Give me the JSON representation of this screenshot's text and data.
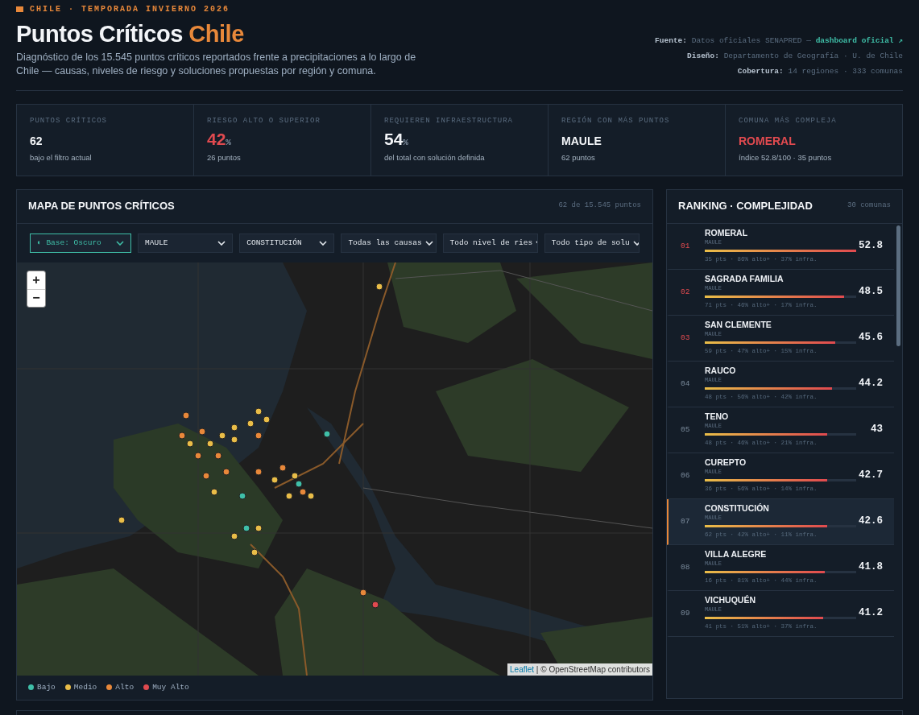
{
  "header": {
    "eyebrow": "CHILE · TEMPORADA INVIERNO 2026",
    "title": "Puntos Críticos",
    "title_accent": "Chile",
    "description": "Diagnóstico de los 15.545 puntos críticos reportados frente a precipitaciones a lo largo de Chile — causas, niveles de riesgo y soluciones propuestas por región y comuna.",
    "meta": [
      {
        "label": "Fuente:",
        "value": "Datos oficiales SENAPRED —",
        "link": "dashboard oficial ↗"
      },
      {
        "label": "Diseño:",
        "value": "Departamento de Geografía · U. de Chile"
      },
      {
        "label": "Cobertura:",
        "value": "14 regiones · 333 comunas"
      }
    ]
  },
  "stats": [
    {
      "label": "PUNTOS CRÍTICOS",
      "value": "62",
      "alert": false,
      "note": "bajo el filtro actual"
    },
    {
      "label": "RIESGO ALTO O SUPERIOR",
      "value": "42",
      "unit": "%",
      "alert": true,
      "note": "26 puntos"
    },
    {
      "label": "REQUIEREN INFRAESTRUCTURA",
      "value": "54",
      "unit": "%",
      "alert": false,
      "note": "del total con solución definida"
    },
    {
      "label": "REGIÓN CON MÁS PUNTOS",
      "value": "MAULE",
      "alert": false,
      "note": "62 puntos"
    },
    {
      "label": "COMUNA MÁS COMPLEJA",
      "value": "ROMERAL",
      "alert": true,
      "note": "índice 52.8/100 · 35 puntos"
    }
  ],
  "map_panel": {
    "title": "MAPA DE PUNTOS CRÍTICOS",
    "count": "62 de 15.545 puntos",
    "filters": [
      {
        "label": "Base: Oscuro",
        "icon": "◐",
        "active": true
      },
      {
        "label": "MAULE",
        "active": false
      },
      {
        "label": "CONSTITUCIÓN",
        "active": false
      },
      {
        "label": "Todas las causas",
        "active": false
      },
      {
        "label": "Todo nivel de ries",
        "active": false
      },
      {
        "label": "Todo tipo de solu",
        "active": false
      }
    ],
    "zoom": [
      "+",
      "−"
    ],
    "attribution": {
      "link": "Leaflet",
      "text": "| © OpenStreetMap contributors"
    },
    "legend": [
      {
        "label": "Bajo",
        "color": "#3fbfa8"
      },
      {
        "label": "Medio",
        "color": "#e9bd48"
      },
      {
        "label": "Alto",
        "color": "#e8883a"
      },
      {
        "label": "Muy Alto",
        "color": "#e04a4f"
      }
    ]
  },
  "ranking": {
    "title": "RANKING · COMPLEJIDAD",
    "count": "30 comunas",
    "rows": [
      {
        "rank": "01",
        "name": "ROMERAL",
        "region": "MAULE",
        "level": 1.0,
        "stats": "35 pts · 86% alto+ · 37% infra.",
        "score": "52.8",
        "top": true,
        "selected": false
      },
      {
        "rank": "02",
        "name": "SAGRADA FAMILIA",
        "region": "MAULE",
        "level": 0.92,
        "stats": "71 pts · 46% alto+ · 17% infra.",
        "score": "48.5",
        "top": true,
        "selected": false
      },
      {
        "rank": "03",
        "name": "SAN CLEMENTE",
        "region": "MAULE",
        "level": 0.86,
        "stats": "59 pts · 47% alto+ · 15% infra.",
        "score": "45.6",
        "top": true,
        "selected": false
      },
      {
        "rank": "04",
        "name": "RAUCO",
        "region": "MAULE",
        "level": 0.84,
        "stats": "48 pts · 56% alto+ · 42% infra.",
        "score": "44.2",
        "top": false,
        "selected": false
      },
      {
        "rank": "05",
        "name": "TENO",
        "region": "MAULE",
        "level": 0.81,
        "stats": "48 pts · 46% alto+ · 21% infra.",
        "score": "43",
        "top": false,
        "selected": false
      },
      {
        "rank": "06",
        "name": "CUREPTO",
        "region": "MAULE",
        "level": 0.81,
        "stats": "36 pts · 56% alto+ · 14% infra.",
        "score": "42.7",
        "top": false,
        "selected": false
      },
      {
        "rank": "07",
        "name": "CONSTITUCIÓN",
        "region": "MAULE",
        "level": 0.81,
        "stats": "62 pts · 42% alto+ · 11% infra.",
        "score": "42.6",
        "top": false,
        "selected": true
      },
      {
        "rank": "08",
        "name": "VILLA ALEGRE",
        "region": "MAULE",
        "level": 0.79,
        "stats": "16 pts · 81% alto+ · 44% infra.",
        "score": "41.8",
        "top": false,
        "selected": false
      },
      {
        "rank": "09",
        "name": "VICHUQUÉN",
        "region": "MAULE",
        "level": 0.78,
        "stats": "41 pts · 51% alto+ · 37% infra.",
        "score": "41.2",
        "top": false,
        "selected": false
      }
    ]
  }
}
